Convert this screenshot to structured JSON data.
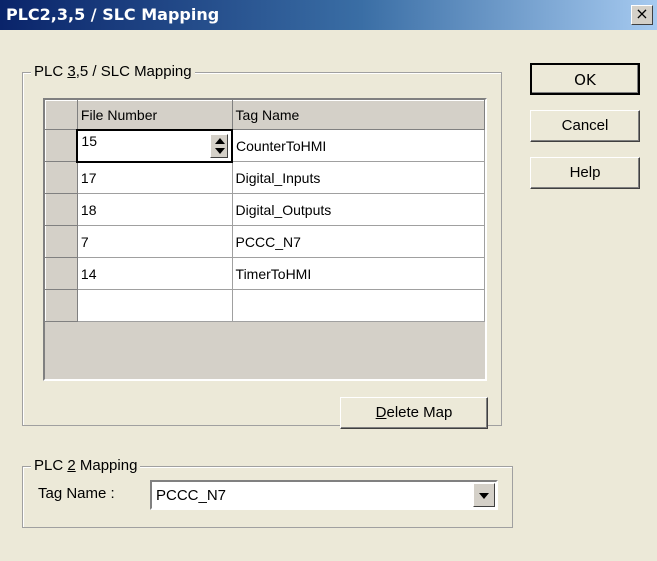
{
  "window": {
    "title": "PLC2,3,5 / SLC Mapping",
    "close_label": "×"
  },
  "slc_group": {
    "legend_pre": "PLC ",
    "legend_key": "3",
    "legend_post": ",5 / SLC Mapping",
    "columns": [
      "File Number",
      "Tag Name"
    ],
    "rows": [
      {
        "file": "15",
        "tag": "CounterToHMI"
      },
      {
        "file": "17",
        "tag": "Digital_Inputs"
      },
      {
        "file": "18",
        "tag": "Digital_Outputs"
      },
      {
        "file": "7",
        "tag": "PCCC_N7"
      },
      {
        "file": "14",
        "tag": "TimerToHMI"
      },
      {
        "file": "",
        "tag": ""
      }
    ],
    "delete_key": "D",
    "delete_rest": "elete Map"
  },
  "plc2_group": {
    "legend_pre": "PLC ",
    "legend_key": "2",
    "legend_post": " Mapping",
    "tag_label": "Tag Name :",
    "tag_value": "PCCC_N7"
  },
  "buttons": {
    "ok": "OK",
    "cancel": "Cancel",
    "help": "Help"
  }
}
